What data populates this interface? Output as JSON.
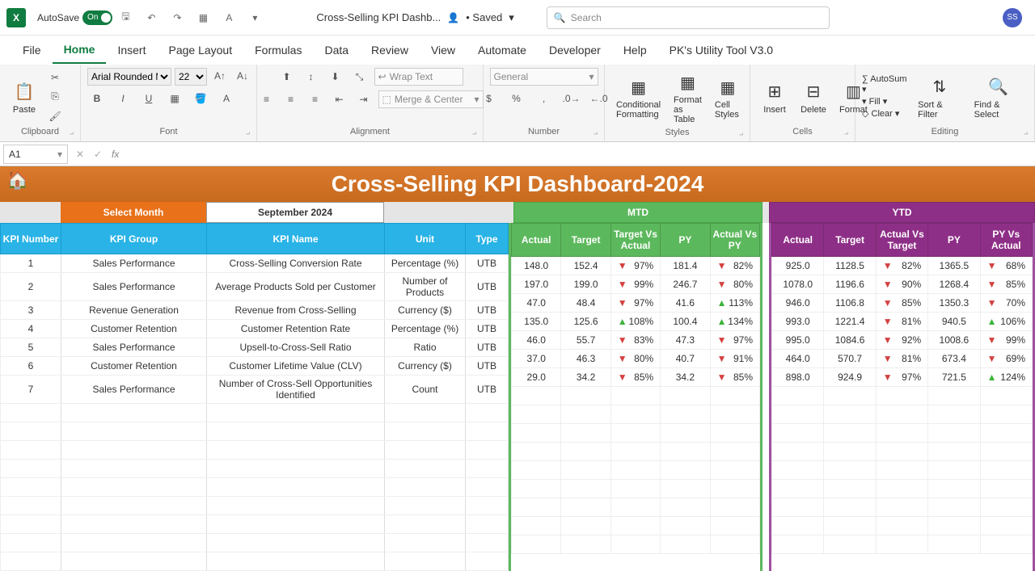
{
  "titlebar": {
    "autosave": "AutoSave",
    "autosave_state": "On",
    "doc_name": "Cross-Selling KPI Dashb...",
    "saved": "• Saved",
    "search_placeholder": "Search",
    "avatar": "SS"
  },
  "tabs": [
    "File",
    "Home",
    "Insert",
    "Page Layout",
    "Formulas",
    "Data",
    "Review",
    "View",
    "Automate",
    "Developer",
    "Help",
    "PK's Utility Tool V3.0"
  ],
  "ribbon": {
    "paste": "Paste",
    "clipboard": "Clipboard",
    "font_name": "Arial Rounded MT",
    "font_size": "22",
    "font": "Font",
    "wrap": "Wrap Text",
    "merge": "Merge & Center",
    "alignment": "Alignment",
    "num_format": "General",
    "number": "Number",
    "cond": "Conditional Formatting",
    "fmt_tbl": "Format as Table",
    "cell_styles": "Cell Styles",
    "styles": "Styles",
    "insert": "Insert",
    "delete": "Delete",
    "format": "Format",
    "cells": "Cells",
    "autosum": "AutoSum",
    "fill": "Fill",
    "clear": "Clear",
    "sort": "Sort & Filter",
    "find": "Find & Select",
    "editing": "Editing"
  },
  "cellref": "A1",
  "dash": {
    "title": "Cross-Selling KPI Dashboard-2024",
    "select_month": "Select Month",
    "month": "September 2024",
    "mtd": "MTD",
    "ytd": "YTD",
    "hdr_left": [
      "KPI Number",
      "KPI Group",
      "KPI Name",
      "Unit",
      "Type"
    ],
    "hdr_mtd": [
      "Actual",
      "Target",
      "Target Vs Actual",
      "PY",
      "Actual Vs PY"
    ],
    "hdr_ytd": [
      "Actual",
      "Target",
      "Actual Vs Target",
      "PY",
      "PY Vs Actual"
    ],
    "rows": [
      {
        "n": "1",
        "grp": "Sales Performance",
        "name": "Cross-Selling Conversion Rate",
        "unit": "Percentage (%)",
        "type": "UTB",
        "m": [
          "148.0",
          "152.4",
          "d|97%",
          "181.4",
          "d|82%"
        ],
        "y": [
          "925.0",
          "1128.5",
          "d|82%",
          "1365.5",
          "d|68%"
        ]
      },
      {
        "n": "2",
        "grp": "Sales Performance",
        "name": "Average Products Sold per Customer",
        "unit": "Number of Products",
        "type": "UTB",
        "m": [
          "197.0",
          "199.0",
          "d|99%",
          "246.7",
          "d|80%"
        ],
        "y": [
          "1078.0",
          "1196.6",
          "d|90%",
          "1268.4",
          "d|85%"
        ]
      },
      {
        "n": "3",
        "grp": "Revenue Generation",
        "name": "Revenue from Cross-Selling",
        "unit": "Currency ($)",
        "type": "UTB",
        "m": [
          "47.0",
          "48.4",
          "d|97%",
          "41.6",
          "u|113%"
        ],
        "y": [
          "946.0",
          "1106.8",
          "d|85%",
          "1350.3",
          "d|70%"
        ]
      },
      {
        "n": "4",
        "grp": "Customer Retention",
        "name": "Customer Retention Rate",
        "unit": "Percentage (%)",
        "type": "UTB",
        "m": [
          "135.0",
          "125.6",
          "u|108%",
          "100.4",
          "u|134%"
        ],
        "y": [
          "993.0",
          "1221.4",
          "d|81%",
          "940.5",
          "u|106%"
        ]
      },
      {
        "n": "5",
        "grp": "Sales Performance",
        "name": "Upsell-to-Cross-Sell Ratio",
        "unit": "Ratio",
        "type": "UTB",
        "m": [
          "46.0",
          "55.7",
          "d|83%",
          "47.3",
          "d|97%"
        ],
        "y": [
          "995.0",
          "1084.6",
          "d|92%",
          "1008.6",
          "d|99%"
        ]
      },
      {
        "n": "6",
        "grp": "Customer Retention",
        "name": "Customer Lifetime Value (CLV)",
        "unit": "Currency ($)",
        "type": "UTB",
        "m": [
          "37.0",
          "46.3",
          "d|80%",
          "40.7",
          "d|91%"
        ],
        "y": [
          "464.0",
          "570.7",
          "d|81%",
          "673.4",
          "d|69%"
        ]
      },
      {
        "n": "7",
        "grp": "Sales Performance",
        "name": "Number of Cross-Sell Opportunities Identified",
        "unit": "Count",
        "type": "UTB",
        "m": [
          "29.0",
          "34.2",
          "d|85%",
          "34.2",
          "d|85%"
        ],
        "y": [
          "898.0",
          "924.9",
          "d|97%",
          "721.5",
          "u|124%"
        ]
      }
    ]
  }
}
